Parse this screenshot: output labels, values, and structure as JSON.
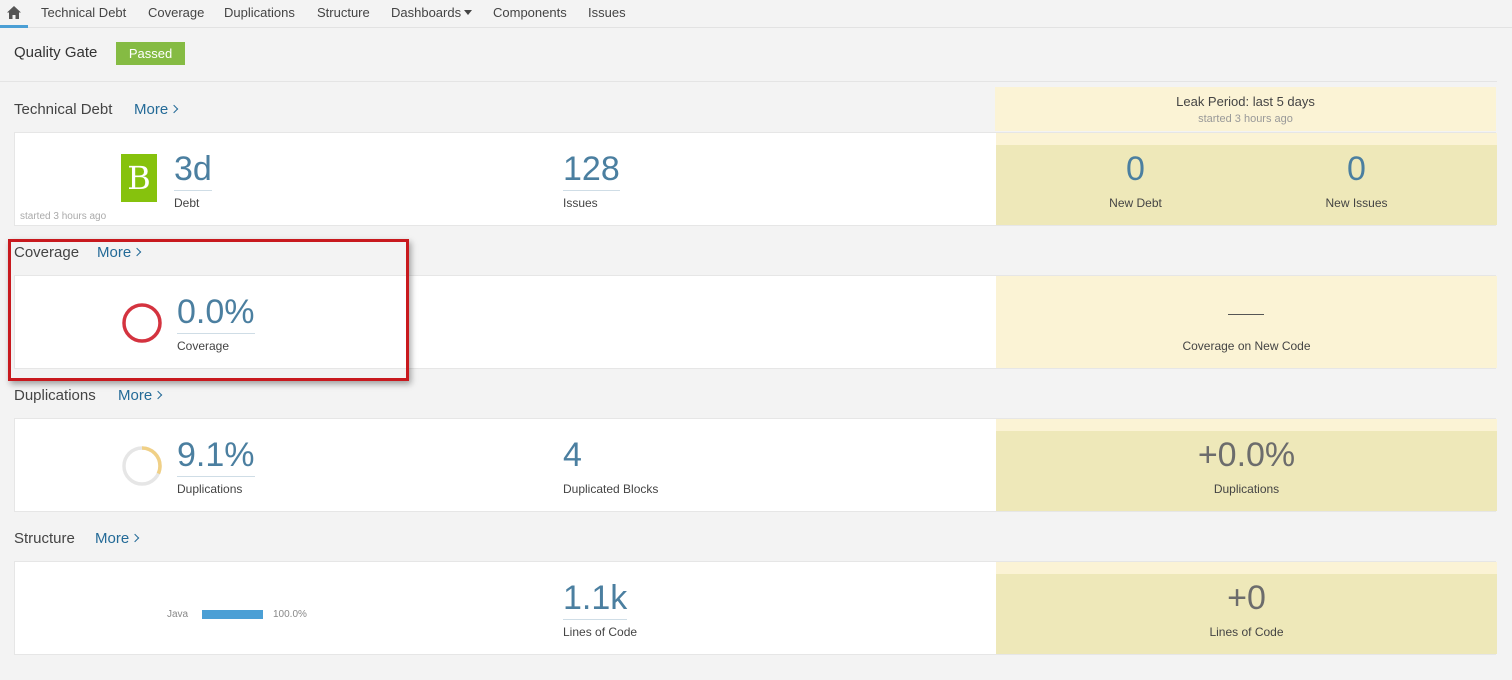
{
  "nav": {
    "home_icon": "home-icon",
    "items": [
      "Technical Debt",
      "Coverage",
      "Duplications",
      "Structure",
      "Dashboards",
      "Components",
      "Issues"
    ]
  },
  "quality_gate": {
    "label": "Quality Gate",
    "status": "Passed",
    "status_color": "#85bb43"
  },
  "leak_period": {
    "title": "Leak Period: last 5 days",
    "subtitle": "started 3 hours ago"
  },
  "more_label": "More",
  "technical_debt": {
    "title": "Technical Debt",
    "rating": "B",
    "rating_color": "#86c20d",
    "note": "started 3 hours ago",
    "debt_value": "3d",
    "debt_label": "Debt",
    "issues_value": "128",
    "issues_label": "Issues",
    "new_debt_value": "0",
    "new_debt_label": "New Debt",
    "new_issues_value": "0",
    "new_issues_label": "New Issues"
  },
  "coverage": {
    "title": "Coverage",
    "value": "0.0%",
    "label": "Coverage",
    "new_code_value": "—",
    "new_code_label": "Coverage on New Code",
    "donut_fraction": 0.0
  },
  "duplications": {
    "title": "Duplications",
    "value": "9.1%",
    "label": "Duplications",
    "blocks_value": "4",
    "blocks_label": "Duplicated Blocks",
    "new_value": "+0.0%",
    "new_label": "Duplications",
    "donut_fraction": 0.091
  },
  "structure": {
    "title": "Structure",
    "language": "Java",
    "language_pct": "100.0%",
    "language_fraction": 1.0,
    "loc_value": "1.1k",
    "loc_label": "Lines of Code",
    "new_loc_value": "+0",
    "new_loc_label": "Lines of Code"
  }
}
